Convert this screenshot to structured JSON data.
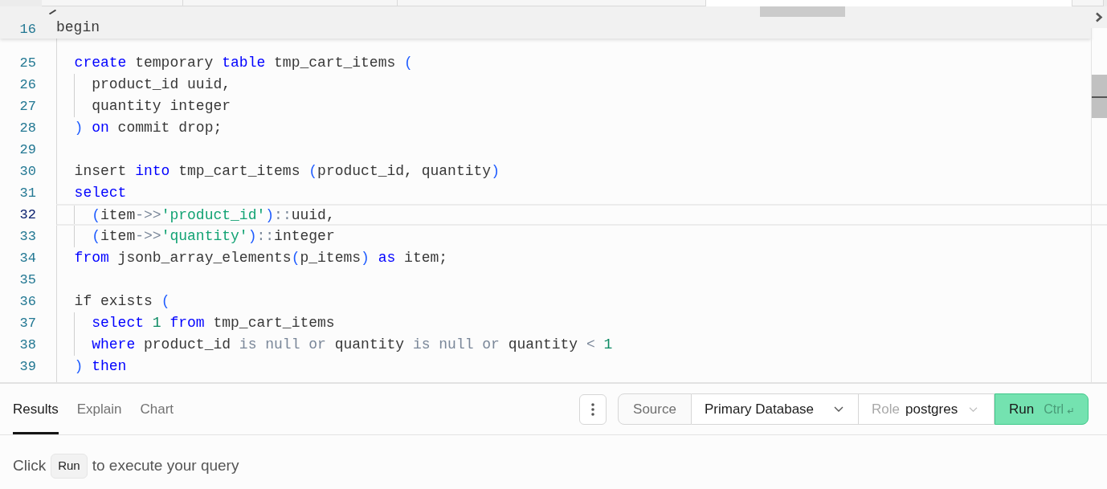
{
  "editor_tabs": [
    {
      "selected": false
    },
    {
      "selected": false
    },
    {
      "selected": false
    },
    {
      "selected": true
    },
    {
      "selected": false
    }
  ],
  "editor": {
    "sticky_line": {
      "number": "16",
      "tokens": [
        {
          "text": "begin",
          "kind": "plain"
        }
      ]
    },
    "lines": [
      {
        "number": "25",
        "current": false,
        "tokens": [
          {
            "text": "  create",
            "kind": "keyword"
          },
          {
            "text": " temporary ",
            "kind": "plain"
          },
          {
            "text": "table",
            "kind": "keyword"
          },
          {
            "text": " tmp_cart_items ",
            "kind": "plain"
          },
          {
            "text": "(",
            "kind": "bracket"
          }
        ]
      },
      {
        "number": "26",
        "current": false,
        "tokens": [
          {
            "text": "    product_id uuid,",
            "kind": "plain"
          }
        ]
      },
      {
        "number": "27",
        "current": false,
        "tokens": [
          {
            "text": "    quantity integer",
            "kind": "plain"
          }
        ]
      },
      {
        "number": "28",
        "current": false,
        "tokens": [
          {
            "text": "  )",
            "kind": "bracket"
          },
          {
            "text": " on",
            "kind": "keyword"
          },
          {
            "text": " commit drop;",
            "kind": "plain"
          }
        ]
      },
      {
        "number": "29",
        "current": false
      },
      {
        "number": "30",
        "current": false,
        "tokens": [
          {
            "text": "  insert ",
            "kind": "plain"
          },
          {
            "text": "into",
            "kind": "keyword"
          },
          {
            "text": " tmp_cart_items ",
            "kind": "plain"
          },
          {
            "text": "(",
            "kind": "bracket"
          },
          {
            "text": "product_id, quantity",
            "kind": "plain"
          },
          {
            "text": ")",
            "kind": "bracket"
          }
        ]
      },
      {
        "number": "31",
        "current": false,
        "tokens": [
          {
            "text": "  select",
            "kind": "keyword"
          }
        ]
      },
      {
        "number": "32",
        "current": true,
        "tokens": [
          {
            "text": "    (",
            "kind": "bracket"
          },
          {
            "text": "item",
            "kind": "plain"
          },
          {
            "text": "->>",
            "kind": "operator"
          },
          {
            "text": "'product_id'",
            "kind": "string"
          },
          {
            "text": ")",
            "kind": "bracket"
          },
          {
            "text": "::",
            "kind": "operator"
          },
          {
            "text": "uuid,",
            "kind": "plain"
          }
        ]
      },
      {
        "number": "33",
        "current": false,
        "tokens": [
          {
            "text": "    (",
            "kind": "bracket"
          },
          {
            "text": "item",
            "kind": "plain"
          },
          {
            "text": "->>",
            "kind": "operator"
          },
          {
            "text": "'quantity'",
            "kind": "string"
          },
          {
            "text": ")",
            "kind": "bracket"
          },
          {
            "text": "::",
            "kind": "operator"
          },
          {
            "text": "integer",
            "kind": "plain"
          }
        ]
      },
      {
        "number": "34",
        "current": false,
        "tokens": [
          {
            "text": "  from",
            "kind": "keyword"
          },
          {
            "text": " jsonb_array_elements",
            "kind": "plain"
          },
          {
            "text": "(",
            "kind": "bracket"
          },
          {
            "text": "p_items",
            "kind": "plain"
          },
          {
            "text": ")",
            "kind": "bracket"
          },
          {
            "text": " as",
            "kind": "keyword"
          },
          {
            "text": " item;",
            "kind": "plain"
          }
        ]
      },
      {
        "number": "35",
        "current": false
      },
      {
        "number": "36",
        "current": false,
        "tokens": [
          {
            "text": "  if exists ",
            "kind": "plain"
          },
          {
            "text": "(",
            "kind": "bracket"
          }
        ]
      },
      {
        "number": "37",
        "current": false,
        "tokens": [
          {
            "text": "    select",
            "kind": "keyword"
          },
          {
            "text": " 1",
            "kind": "number"
          },
          {
            "text": " from",
            "kind": "keyword"
          },
          {
            "text": " tmp_cart_items",
            "kind": "plain"
          }
        ]
      },
      {
        "number": "38",
        "current": false,
        "tokens": [
          {
            "text": "    where",
            "kind": "keyword"
          },
          {
            "text": " product_id ",
            "kind": "plain"
          },
          {
            "text": "is null or",
            "kind": "operator"
          },
          {
            "text": " quantity ",
            "kind": "plain"
          },
          {
            "text": "is null or",
            "kind": "operator"
          },
          {
            "text": " quantity ",
            "kind": "plain"
          },
          {
            "text": "<",
            "kind": "operator"
          },
          {
            "text": " 1",
            "kind": "number"
          }
        ]
      },
      {
        "number": "39",
        "current": false,
        "tokens": [
          {
            "text": "  )",
            "kind": "bracket"
          },
          {
            "text": " then",
            "kind": "keyword"
          }
        ]
      }
    ]
  },
  "results_tabs": [
    {
      "label": "Results",
      "selected": true
    },
    {
      "label": "Explain",
      "selected": false
    },
    {
      "label": "Chart",
      "selected": false
    }
  ],
  "toolbar": {
    "source": "Source",
    "database": "Primary Database",
    "role_label": "Role",
    "role": "postgres",
    "run": "Run",
    "run_shortcut": "Ctrl"
  },
  "message": {
    "before": "Click",
    "key": "Run",
    "after": "to execute your query"
  }
}
